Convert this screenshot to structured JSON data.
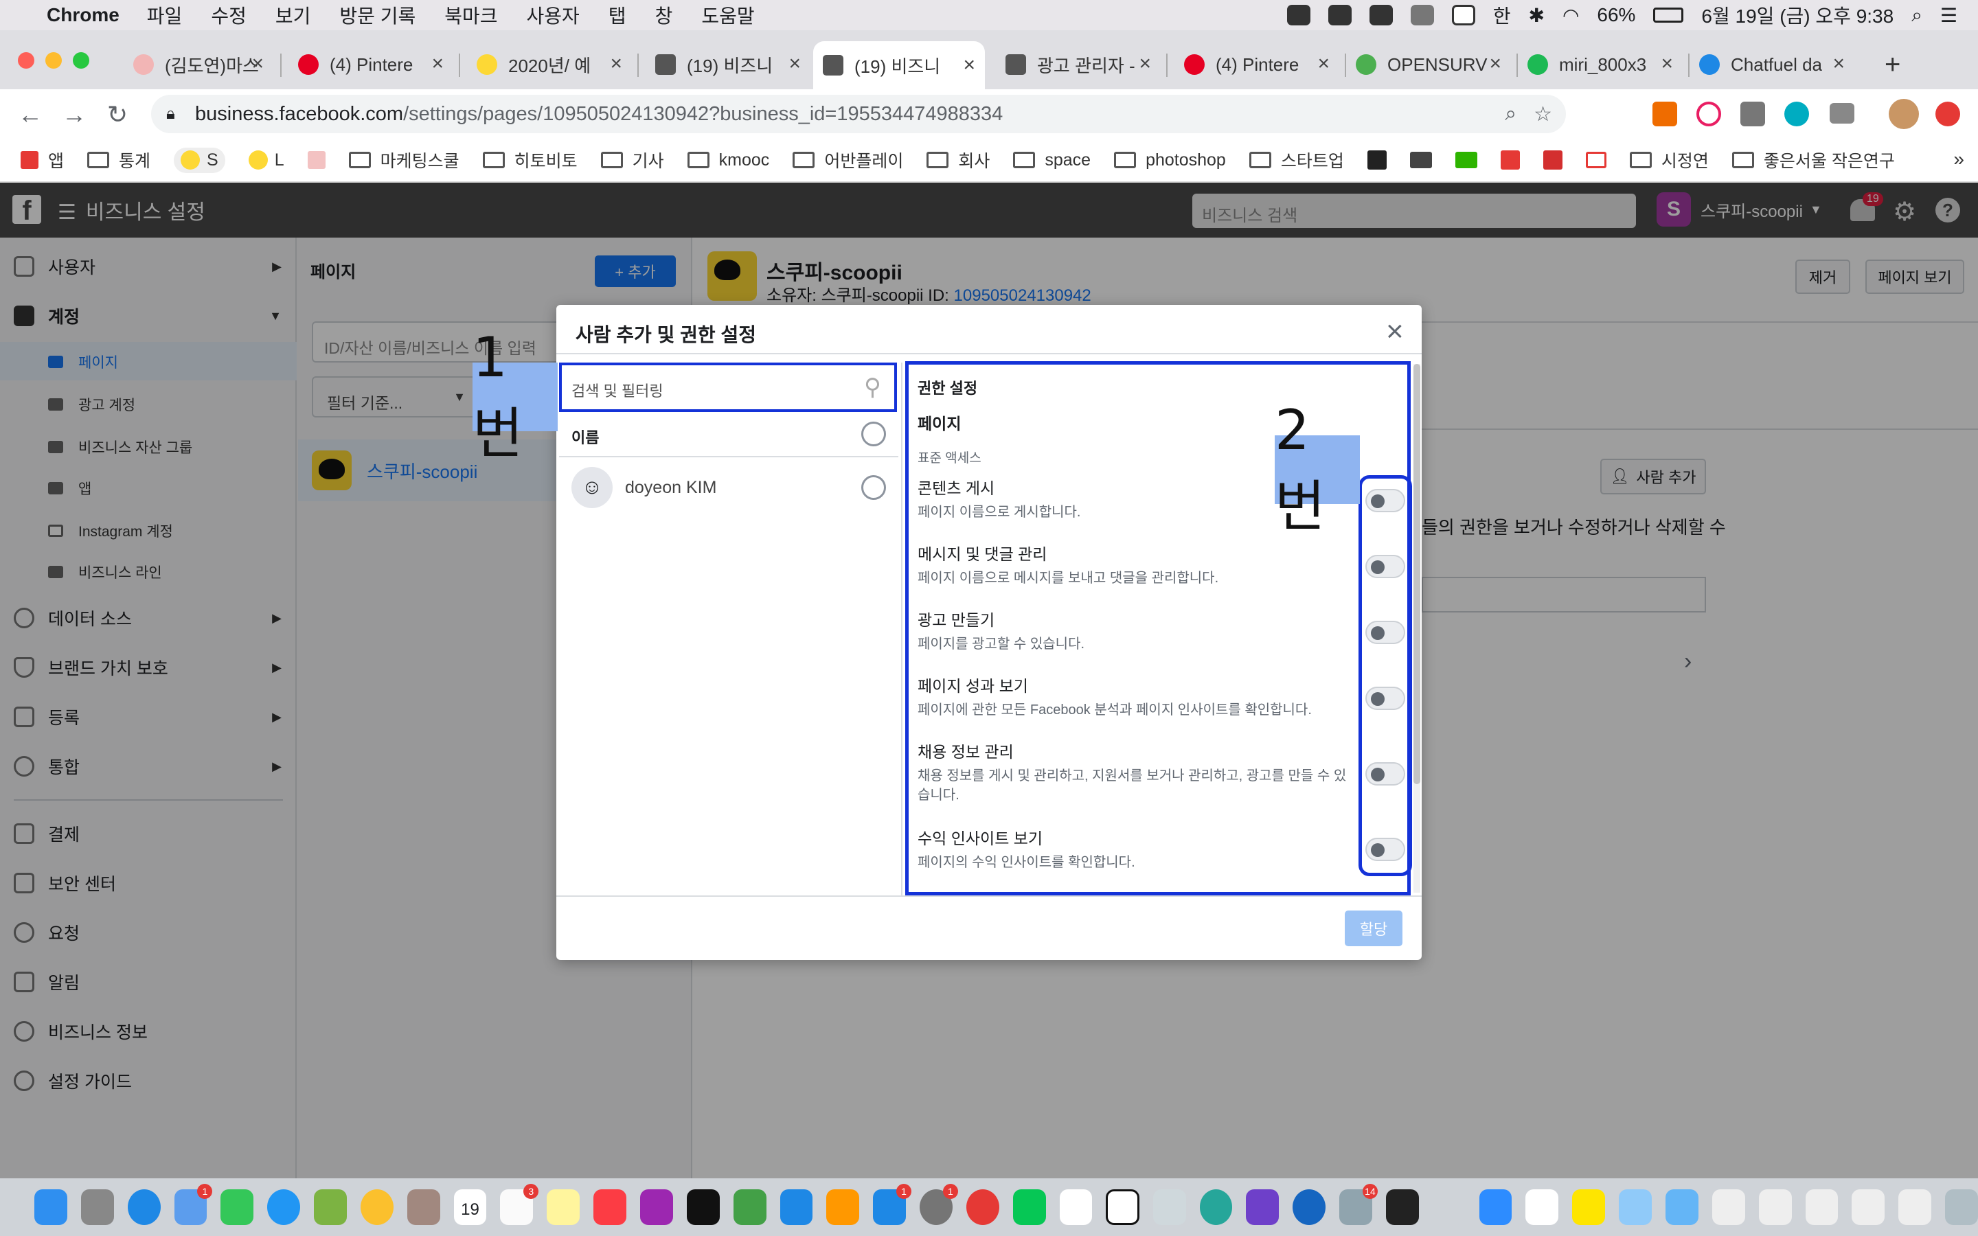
{
  "menubar": {
    "app": "Chrome",
    "items": [
      "파일",
      "수정",
      "보기",
      "방문 기록",
      "북마크",
      "사용자",
      "탭",
      "창",
      "도움말"
    ],
    "battery": "66%",
    "datetime": "6월 19일 (금) 오후 9:38",
    "input_method": "한"
  },
  "tabs": [
    {
      "title": "(김도연)마스",
      "color": "#f2b5b5"
    },
    {
      "title": "(4) Pintere",
      "color": "#e60023"
    },
    {
      "title": "2020년/ 예",
      "color": "#fdd835"
    },
    {
      "title": "(19) 비즈니",
      "color": "#555555"
    },
    {
      "title": "(19) 비즈니",
      "color": "#555555"
    },
    {
      "title": "광고 관리자 -",
      "color": "#555555"
    },
    {
      "title": "(4) Pintere",
      "color": "#e60023"
    },
    {
      "title": "OPENSURV",
      "color": "#4caf50"
    },
    {
      "title": "miri_800x3",
      "color": "#1db954"
    },
    {
      "title": "Chatfuel da",
      "color": "#1e88e5"
    }
  ],
  "url": {
    "host": "business.facebook.com",
    "path": "/settings/pages/109505024130942?business_id=195534474988334"
  },
  "bookmarks": [
    "앱",
    "통계",
    "S",
    "L",
    "",
    "마케팅스쿨",
    "히토비토",
    "기사",
    "kmooc",
    "어반플레이",
    "회사",
    "space",
    "photoshop",
    "스타트업",
    "",
    "",
    "",
    "",
    "",
    "",
    "시정연",
    "좋은서울 작은연구"
  ],
  "fb": {
    "title": "비즈니스 설정",
    "search_placeholder": "비즈니스 검색",
    "profile_name": "스쿠피-scoopii",
    "notif_count": "19"
  },
  "sidebar": {
    "items": [
      {
        "label": "사용자"
      },
      {
        "label": "계정"
      },
      {
        "label": "데이터 소스"
      },
      {
        "label": "브랜드 가치 보호"
      },
      {
        "label": "등록"
      },
      {
        "label": "통합"
      },
      {
        "label": "결제"
      },
      {
        "label": "보안 센터"
      },
      {
        "label": "요청"
      },
      {
        "label": "알림"
      },
      {
        "label": "비즈니스 정보"
      },
      {
        "label": "설정 가이드"
      }
    ],
    "subitems": [
      {
        "label": "페이지"
      },
      {
        "label": "광고 계정"
      },
      {
        "label": "비즈니스 자산 그룹"
      },
      {
        "label": "앱"
      },
      {
        "label": "Instagram 계정"
      },
      {
        "label": "비즈니스 라인"
      }
    ]
  },
  "middle": {
    "header": "페이지",
    "add_label": "+ 추가",
    "search_placeholder": "ID/자산 이름/비즈니스 이름 입력",
    "filter_label": "필터 기준...",
    "page_item": "스쿠피-scoopii"
  },
  "right": {
    "page_name": "스쿠피-scoopii",
    "owner_label": "소유자: 스쿠피-scoopii   ID:",
    "owner_id": "109505024130942",
    "remove_label": "제거",
    "view_page_label": "페이지 보기",
    "add_person_label": "사람 추가",
    "bg_text": "들의 권한을 보거나 수정하거나 삭제할 수"
  },
  "modal": {
    "title": "사람 추가 및 권한 설정",
    "search_placeholder": "검색 및 필터링",
    "name_header": "이름",
    "person": "doyeon KIM",
    "perm_title": "권한 설정",
    "perm_section": "페이지",
    "perm_group": "표준 액세스",
    "permissions": [
      {
        "title": "콘텐츠 게시",
        "desc": "페이지 이름으로 게시합니다.",
        "on": false
      },
      {
        "title": "메시지 및 댓글 관리",
        "desc": "페이지 이름으로 메시지를 보내고 댓글을 관리합니다.",
        "on": false
      },
      {
        "title": "광고 만들기",
        "desc": "페이지를 광고할 수 있습니다.",
        "on": false
      },
      {
        "title": "페이지 성과 보기",
        "desc": "페이지에 관한 모든 Facebook 분석과 페이지 인사이트를 확인합니다.",
        "on": false
      },
      {
        "title": "채용 정보 관리",
        "desc": "채용 정보를 게시 및 관리하고, 지원서를 보거나 관리하고, 광고를 만들 수 있습니다.",
        "on": false
      },
      {
        "title": "수익 인사이트 보기",
        "desc": "페이지의 수익 인사이트를 확인합니다.",
        "on": false
      }
    ],
    "assign_label": "할당",
    "annotation_1": "1번",
    "annotation_2": "2번"
  },
  "dock_badges": [
    "1",
    "3",
    "1",
    "1",
    "14"
  ],
  "dock_calendar_day": "19"
}
